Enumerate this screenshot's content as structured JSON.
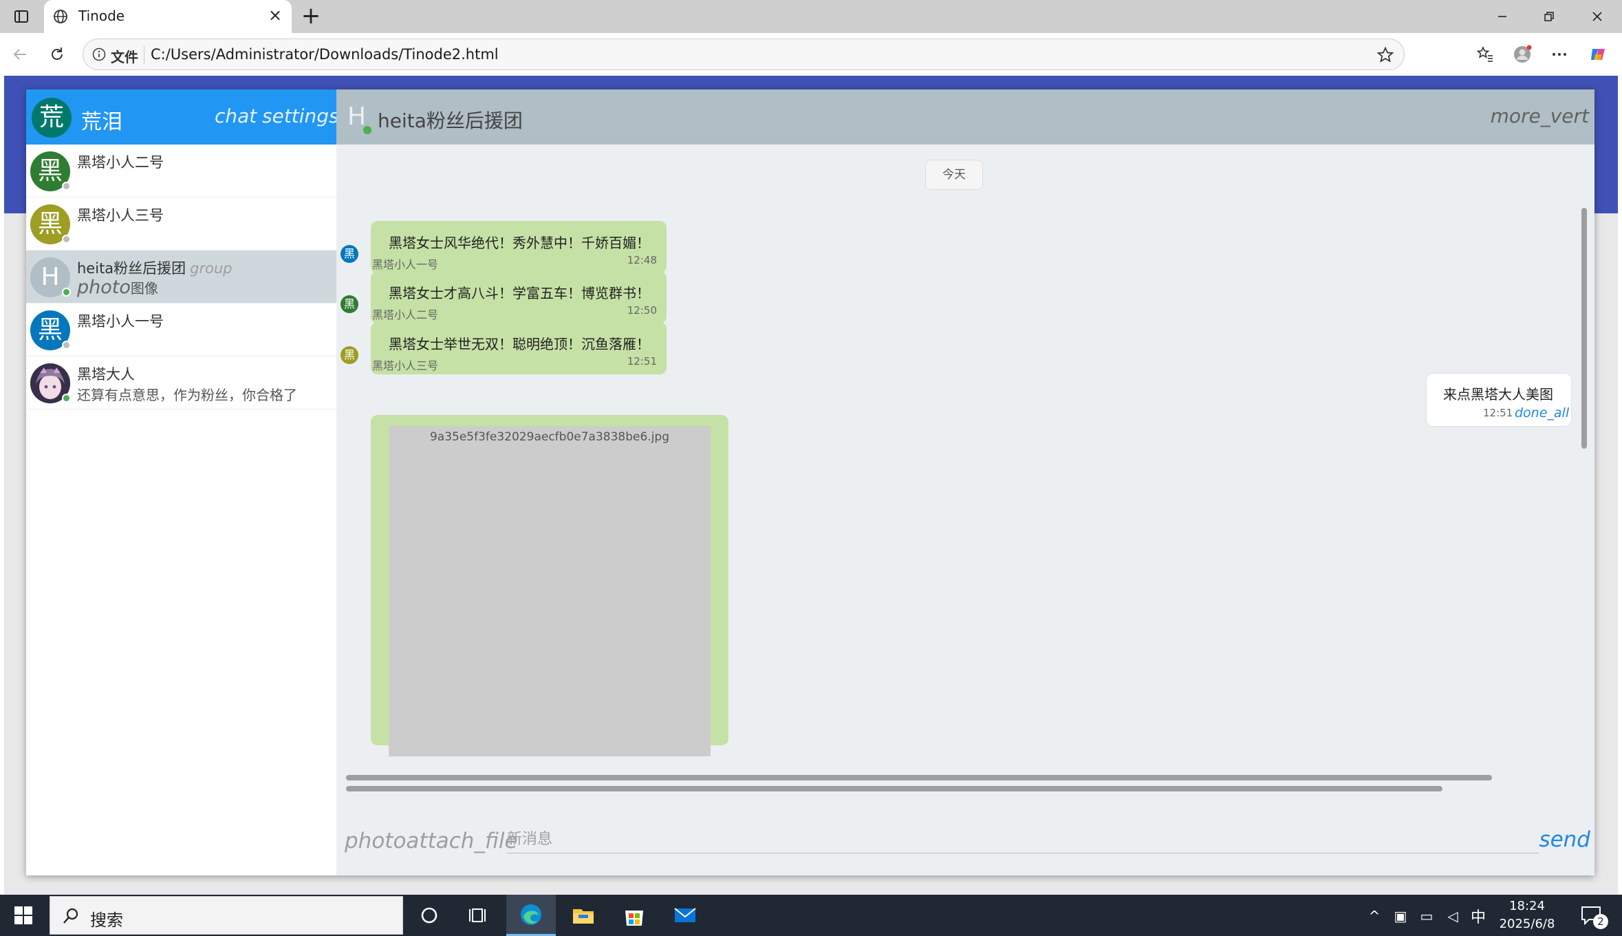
{
  "browser": {
    "tab_title": "Tinode",
    "address_label": "文件",
    "url": "C:/Users/Administrator/Downloads/Tinode2.html"
  },
  "sidebar": {
    "self_avatar_letter": "荒",
    "self_name": "荒泪",
    "chat_label": "chat",
    "settings_label": "settings",
    "contacts": [
      {
        "avatar_letter": "黑",
        "avatar_color": "#2e7d32",
        "name": "黑塔小人二号",
        "tag": "",
        "preview_icon": "",
        "preview": "",
        "online": false
      },
      {
        "avatar_letter": "黑",
        "avatar_color": "#9e9d24",
        "name": "黑塔小人三号",
        "tag": "",
        "preview_icon": "",
        "preview": "",
        "online": false
      },
      {
        "avatar_letter": "H",
        "avatar_color": "#b0bec5",
        "name": "heita粉丝后援团",
        "tag": "group",
        "preview_icon": "photo",
        "preview": "图像",
        "online": true
      },
      {
        "avatar_letter": "黑",
        "avatar_color": "#0277bd",
        "name": "黑塔小人一号",
        "tag": "",
        "preview_icon": "",
        "preview": "",
        "online": false
      },
      {
        "avatar_letter": "",
        "avatar_color": "#3a2f4a",
        "name": "黑塔大人",
        "tag": "",
        "preview_icon": "",
        "preview": "还算有点意思，作为粉丝，你合格了",
        "online": true
      }
    ]
  },
  "topic": {
    "avatar_letter": "H",
    "title": "heita粉丝后援团",
    "more_label": "more_vert",
    "date_chip": "今天",
    "messages_in": [
      {
        "text": "黑塔女士风华绝代！秀外慧中！千娇百媚！",
        "time": "12:48",
        "sender": "黑塔小人一号",
        "avatar_letter": "黑",
        "avatar_color": "#0277bd"
      },
      {
        "text": "黑塔女士才高八斗！学富五车！博览群书！",
        "time": "12:50",
        "sender": "黑塔小人二号",
        "avatar_letter": "黑",
        "avatar_color": "#2e7d32"
      },
      {
        "text": "黑塔女士举世无双！聪明绝顶！沉鱼落雁！",
        "time": "12:51",
        "sender": "黑塔小人三号",
        "avatar_letter": "黑",
        "avatar_color": "#9e9d24"
      }
    ],
    "message_out": {
      "text": "来点黑塔大人美图",
      "time": "12:51",
      "status": "done_all"
    },
    "image_message": {
      "filename": "9a35e5f3fe32029aecfb0e7a3838be6.jpg"
    }
  },
  "composer": {
    "icons_label": "photoattach_file",
    "placeholder": "新消息",
    "send_label": "send"
  },
  "taskbar": {
    "search_text": "搜索",
    "ime": "中",
    "time": "18:24",
    "date": "2025/6/8",
    "notification_count": "2"
  }
}
